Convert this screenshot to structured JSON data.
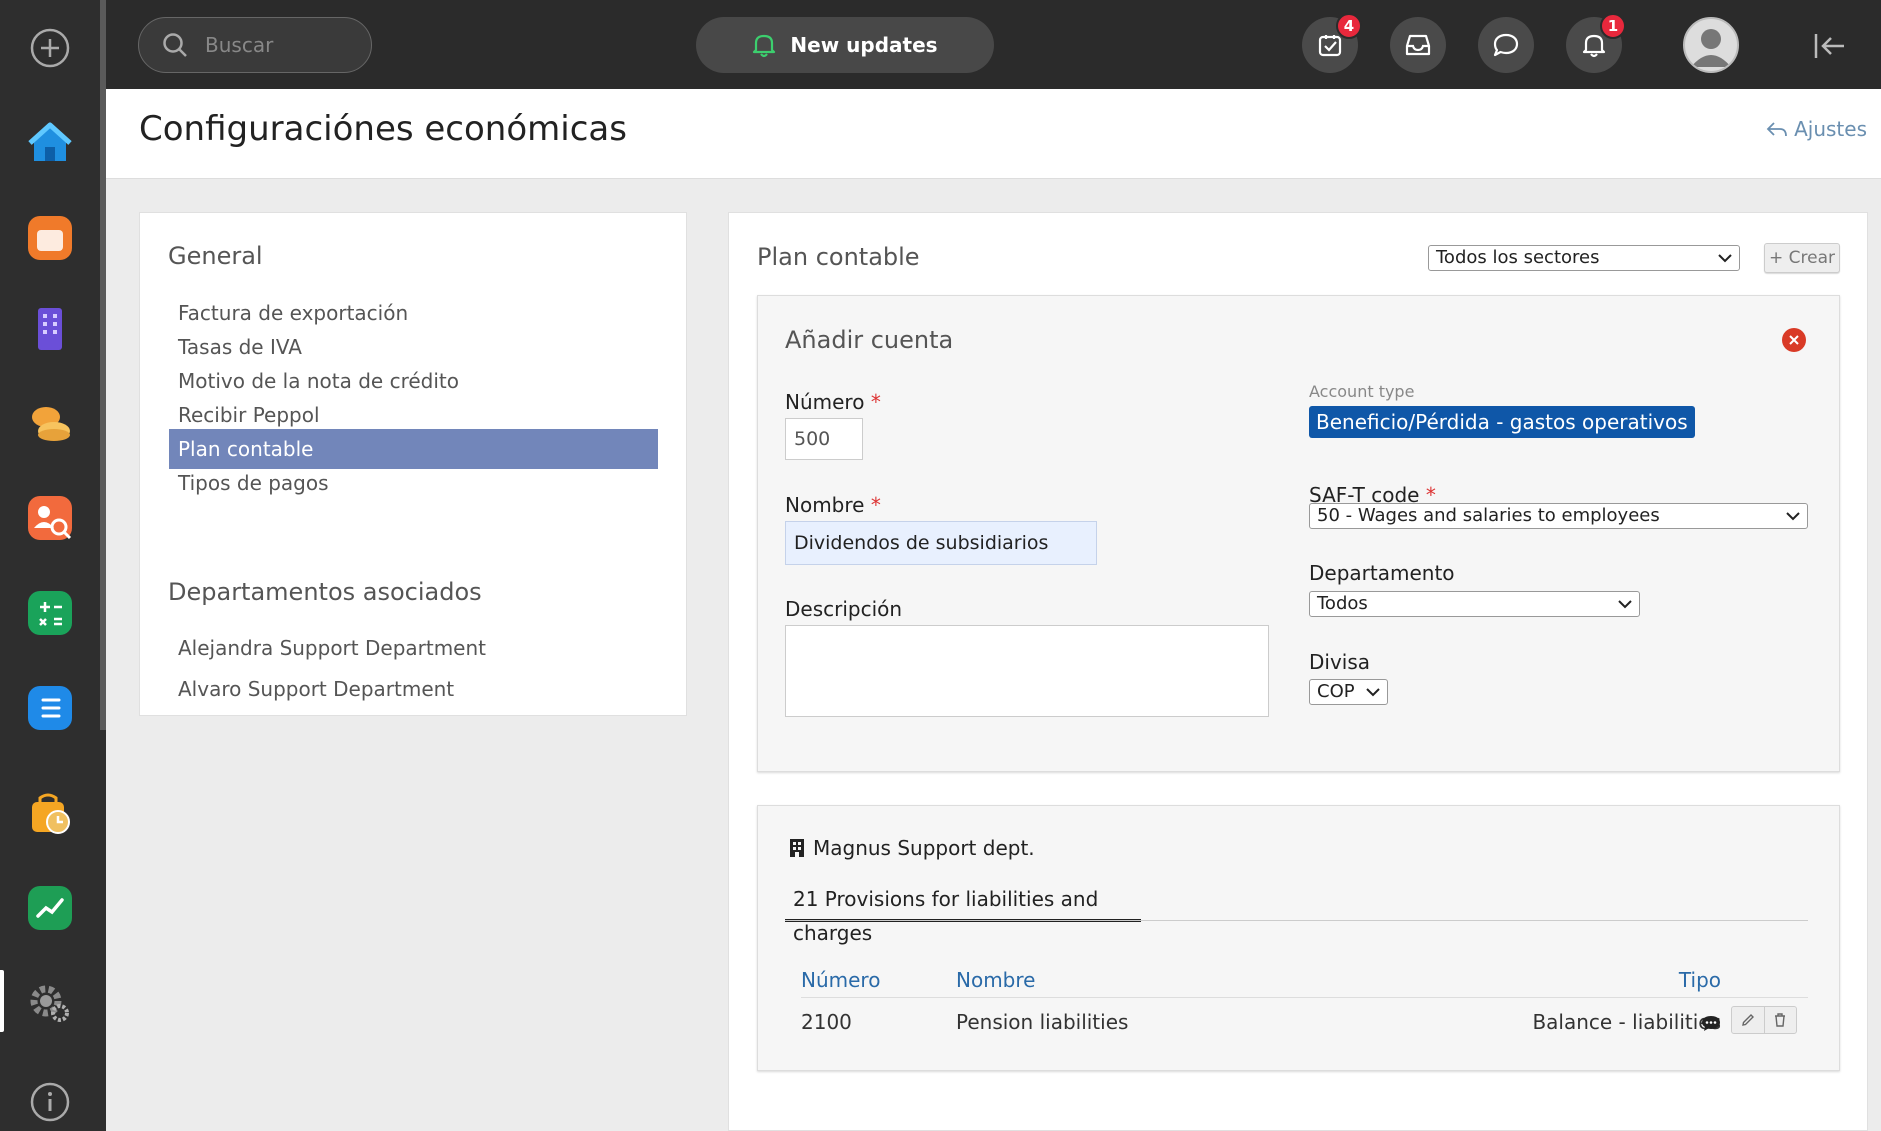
{
  "topbar": {
    "search_placeholder": "Buscar",
    "updates_label": "New updates",
    "tasks_badge": "4",
    "notifications_badge": "1"
  },
  "header": {
    "title": "Configuraciónes económicas",
    "back_link": "Ajustes"
  },
  "sidebar": {
    "general_title": "General",
    "general_items": [
      {
        "label": "Factura de exportación"
      },
      {
        "label": "Tasas de IVA"
      },
      {
        "label": "Motivo de la nota de crédito"
      },
      {
        "label": "Recibir Peppol"
      },
      {
        "label": "Plan contable",
        "active": true
      },
      {
        "label": "Tipos de pagos"
      }
    ],
    "departments_title": "Departamentos asociados",
    "department_items": [
      {
        "label": "Alejandra Support Department"
      },
      {
        "label": "Alvaro Support Department"
      }
    ]
  },
  "main": {
    "title": "Plan contable",
    "sector_filter": "Todos los sectores",
    "create_label": "+ Crear",
    "form": {
      "title": "Añadir cuenta",
      "numero_label": "Número",
      "numero_value": "500",
      "nombre_label": "Nombre",
      "nombre_value": "Dividendos de subsidiarios",
      "descripcion_label": "Descripción",
      "descripcion_value": "",
      "account_type_label": "Account type",
      "account_type_value": "Beneficio/Pérdida - gastos operativos",
      "saft_label": "SAF-T code",
      "saft_value": "50 - Wages and salaries to employees",
      "departamento_label": "Departamento",
      "departamento_value": "Todos",
      "divisa_label": "Divisa",
      "divisa_value": "COP",
      "required_mark": "*"
    },
    "accounts": {
      "department": "Magnus Support dept.",
      "tab": "21 Provisions for liabilities and charges",
      "columns": [
        "Número",
        "Nombre",
        "Tipo"
      ],
      "rows": [
        {
          "numero": "2100",
          "nombre": "Pension liabilities",
          "tipo": "Balance - liabilities"
        }
      ]
    }
  },
  "colors": {
    "accent": "#7286ba",
    "account_type_bg": "#0f57a8",
    "badge": "#e8283c",
    "link": "#2a6aa8"
  }
}
